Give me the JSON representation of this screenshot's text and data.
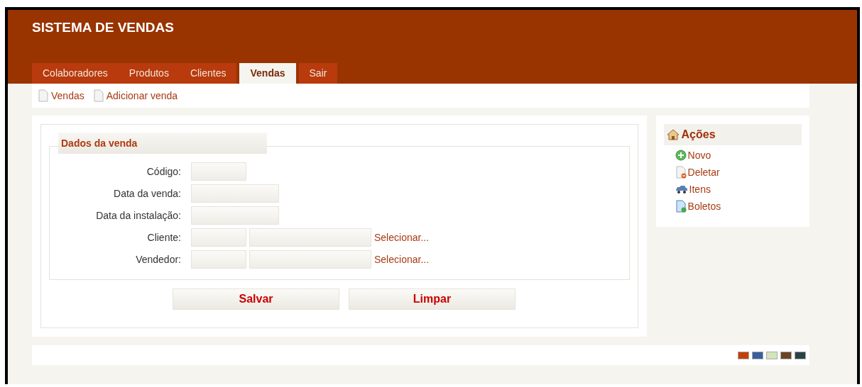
{
  "header": {
    "title": "SISTEMA DE VENDAS"
  },
  "tabs": [
    {
      "label": "Colaboradores",
      "selected": false
    },
    {
      "label": "Produtos",
      "selected": false
    },
    {
      "label": "Clientes",
      "selected": false
    },
    {
      "label": "Vendas",
      "selected": true
    },
    {
      "label": "Sair",
      "selected": false
    }
  ],
  "subnav": [
    "Vendas",
    "Adicionar venda"
  ],
  "form": {
    "legend": "Dados da venda",
    "rows": [
      {
        "label": "Código:",
        "kind": "short"
      },
      {
        "label": "Data da venda:",
        "kind": "medium"
      },
      {
        "label": "Data da instalação:",
        "kind": "medium"
      },
      {
        "label": "Cliente:",
        "kind": "lookup",
        "link": "Selecionar..."
      },
      {
        "label": "Vendedor:",
        "kind": "lookup",
        "link": "Selecionar..."
      }
    ],
    "buttons": [
      "Salvar",
      "Limpar"
    ]
  },
  "actions": {
    "title": "Ações",
    "items": [
      {
        "label": "Novo",
        "kind": "add"
      },
      {
        "label": "Deletar",
        "kind": "delete"
      },
      {
        "label": "Itens",
        "kind": "car"
      },
      {
        "label": "Boletos",
        "kind": "doc"
      }
    ]
  },
  "themes": [
    {
      "color": "#c0400c"
    },
    {
      "color": "#3a5f9a"
    },
    {
      "color": "#d4e3bc"
    },
    {
      "color": "#6b4423"
    },
    {
      "color": "#2a4245"
    }
  ]
}
